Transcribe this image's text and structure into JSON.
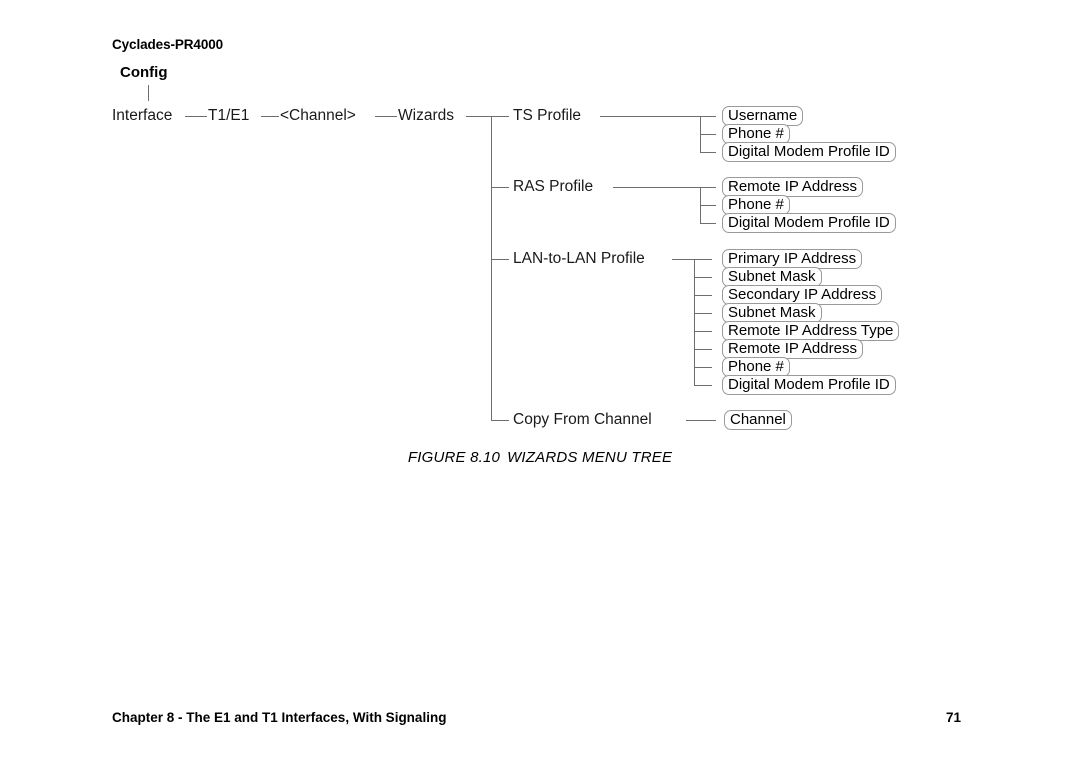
{
  "document": {
    "header": "Cyclades-PR4000",
    "footer_left": "Chapter 8 - The E1 and T1 Interfaces, With Signaling",
    "page_number": "71"
  },
  "figure": {
    "caption_number": "FIGURE 8.10",
    "caption_title": "WIZARDS MENU TREE"
  },
  "colors": {
    "text": "#000000",
    "line": "#6e6e6e",
    "box_border": "#9a9a9a",
    "background": "#ffffff"
  },
  "chart_data": {
    "type": "diagram",
    "title": "WIZARDS MENU TREE",
    "root": "Config",
    "breadcrumb": [
      "Interface",
      "T1/E1",
      "<Channel>",
      "Wizards"
    ],
    "branches": [
      {
        "label": "TS Profile",
        "children": [
          "Username",
          "Phone #",
          "Digital Modem Profile ID"
        ]
      },
      {
        "label": "RAS Profile",
        "children": [
          "Remote IP Address",
          "Phone #",
          "Digital Modem Profile ID"
        ]
      },
      {
        "label": "LAN-to-LAN Profile",
        "children": [
          "Primary IP Address",
          "Subnet Mask",
          "Secondary IP Address",
          "Subnet Mask",
          "Remote IP Address Type",
          "Remote IP Address",
          "Phone #",
          "Digital Modem Profile ID"
        ]
      },
      {
        "label": "Copy From Channel",
        "children": [
          "Channel"
        ]
      }
    ]
  },
  "tree": {
    "root_label": "Config",
    "level1": {
      "interface": "Interface",
      "t1e1": "T1/E1",
      "channel": "<Channel>",
      "wizards": "Wizards"
    },
    "branch_labels": {
      "ts_profile": "TS Profile",
      "ras_profile": "RAS Profile",
      "lan_to_lan_profile": "LAN-to-LAN Profile",
      "copy_from_channel": "Copy From Channel"
    },
    "ts_children": [
      "Username",
      "Phone #",
      "Digital Modem Profile ID"
    ],
    "ras_children": [
      "Remote IP Address",
      "Phone #",
      "Digital Modem Profile ID"
    ],
    "lan_children": [
      "Primary IP Address",
      "Subnet Mask",
      "Secondary IP Address",
      "Subnet Mask",
      "Remote IP Address Type",
      "Remote IP Address",
      "Phone #",
      "Digital Modem Profile ID"
    ],
    "copy_children": [
      "Channel"
    ]
  }
}
